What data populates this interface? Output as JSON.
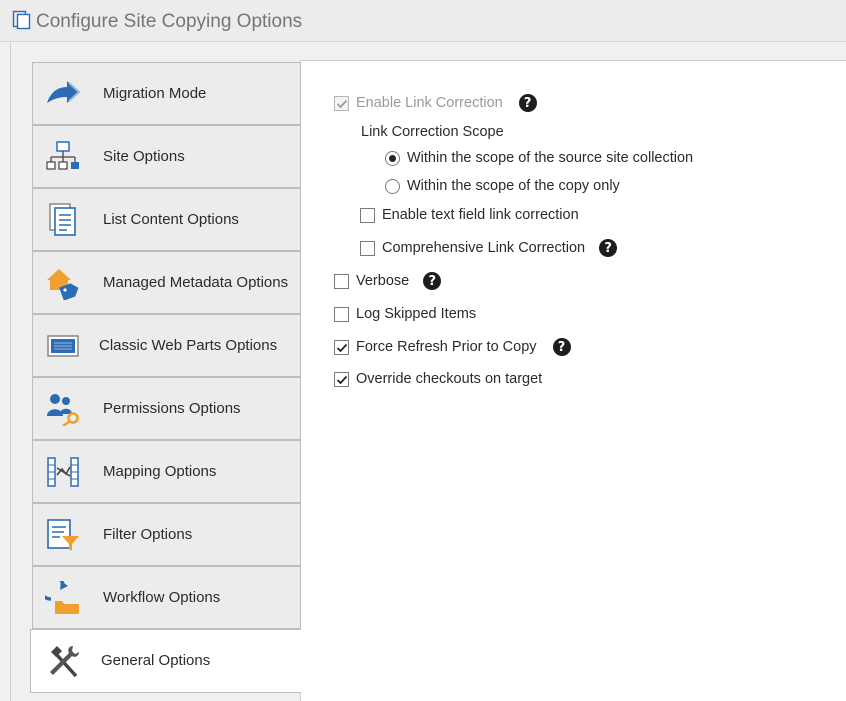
{
  "window": {
    "title": "Configure Site Copying Options",
    "icon": "copy-document-icon"
  },
  "tabs": [
    {
      "label": "Migration Mode",
      "icon": "arrow-forward-icon",
      "selected": false
    },
    {
      "label": "Site Options",
      "icon": "sitemap-icon",
      "selected": false
    },
    {
      "label": "List Content Options",
      "icon": "document-list-icon",
      "selected": false
    },
    {
      "label": "Managed Metadata Options",
      "icon": "home-tag-icon",
      "selected": false
    },
    {
      "label": "Classic Web Parts Options",
      "icon": "web-part-icon",
      "selected": false
    },
    {
      "label": "Permissions Options",
      "icon": "users-key-icon",
      "selected": false
    },
    {
      "label": "Mapping Options",
      "icon": "mapping-icon",
      "selected": false
    },
    {
      "label": "Filter Options",
      "icon": "filter-icon",
      "selected": false
    },
    {
      "label": "Workflow Options",
      "icon": "workflow-folder-icon",
      "selected": false
    },
    {
      "label": "General Options",
      "icon": "tools-icon",
      "selected": true
    }
  ],
  "options": {
    "enable_link_correction": {
      "label": "Enable Link Correction",
      "checked": true,
      "disabled": true,
      "help": "?"
    },
    "scope_heading": "Link Correction Scope",
    "scope_source": {
      "label": "Within the scope of the source site collection",
      "selected": true
    },
    "scope_copy": {
      "label": "Within the scope of the copy only",
      "selected": false
    },
    "text_field_link": {
      "label": "Enable text field link correction",
      "checked": false
    },
    "comprehensive": {
      "label": "Comprehensive Link Correction",
      "checked": false,
      "help": "?"
    },
    "verbose": {
      "label": "Verbose",
      "checked": false,
      "help": "?"
    },
    "log_skipped": {
      "label": "Log Skipped Items",
      "checked": false
    },
    "force_refresh": {
      "label": "Force Refresh Prior to Copy",
      "checked": true,
      "help": "?"
    },
    "override_checkouts": {
      "label": "Override checkouts on target",
      "checked": true
    }
  },
  "colors": {
    "accent_blue": "#2b6cb5",
    "accent_orange": "#f0a030",
    "help_icon": "#1e1e1e"
  }
}
